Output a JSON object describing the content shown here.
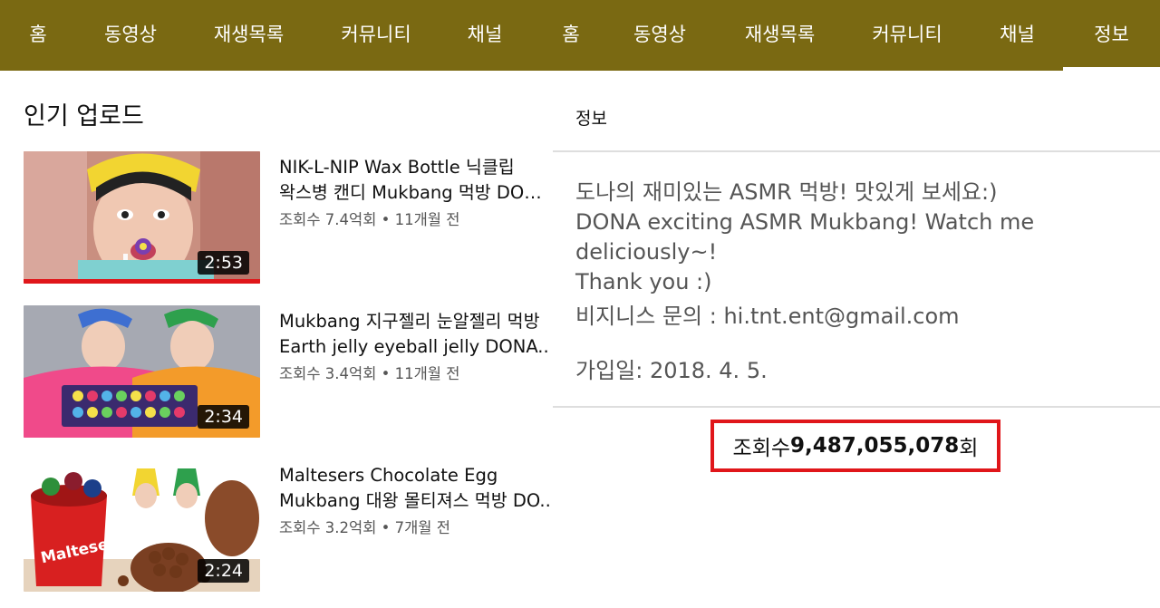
{
  "nav_left": {
    "tabs": [
      {
        "label": "홈"
      },
      {
        "label": "동영상"
      },
      {
        "label": "재생목록"
      },
      {
        "label": "커뮤니티"
      },
      {
        "label": "채널"
      }
    ]
  },
  "nav_right": {
    "tabs": [
      {
        "label": "홈"
      },
      {
        "label": "동영상"
      },
      {
        "label": "재생목록"
      },
      {
        "label": "커뮤니티"
      },
      {
        "label": "채널"
      },
      {
        "label": "정보"
      }
    ],
    "active_tab": "정보"
  },
  "popular": {
    "title": "인기 업로드",
    "videos": [
      {
        "title_line1": "NIK-L-NIP Wax Bottle 닉클립",
        "title_line2": "왁스병 캔디 Mukbang 먹방 DON...",
        "views": "조회수 7.4억회",
        "age": "11개월 전",
        "duration": "2:53",
        "watched_fraction": 1.0
      },
      {
        "title_line1": "Mukbang 지구젤리 눈알젤리 먹방",
        "title_line2": "Earth jelly eyeball jelly DONA..",
        "views": "조회수 3.4억회",
        "age": "11개월 전",
        "duration": "2:34",
        "watched_fraction": 0
      },
      {
        "title_line1": "Maltesers Chocolate Egg",
        "title_line2": "Mukbang 대왕 몰티져스 먹방 DO..",
        "views": "조회수 3.2억회",
        "age": "7개월 전",
        "duration": "2:24",
        "watched_fraction": 0
      }
    ]
  },
  "about": {
    "header": "정보",
    "description": [
      "도나의 재미있는 ASMR 먹방! 맛있게 보세요:)",
      "DONA exciting ASMR Mukbang! Watch me deliciously~!",
      "Thank you :)"
    ],
    "business": "비지니스 문의 : hi.tnt.ent@gmail.com",
    "joined": "가입일: 2018. 4. 5.",
    "views_prefix": "조회수 ",
    "views_number": "9,487,055,078",
    "views_suffix": "회"
  },
  "colors": {
    "tabbar": "#7a6912",
    "highlight_border": "#e0161a",
    "progress": "#e0161a"
  }
}
